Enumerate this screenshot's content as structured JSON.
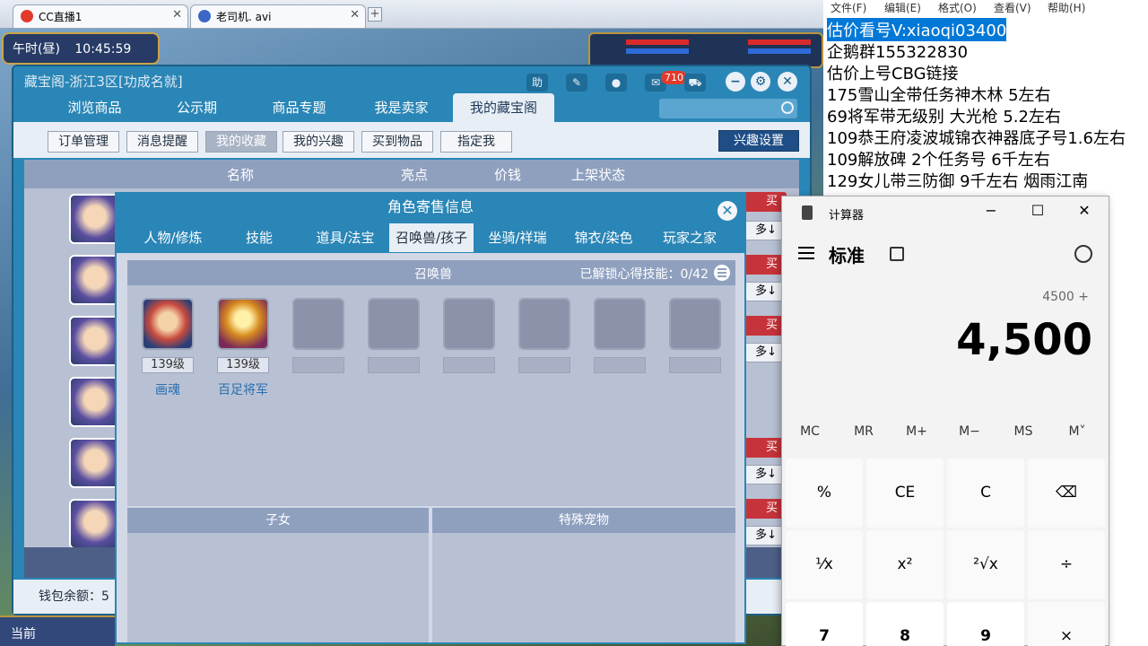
{
  "browser": {
    "tabs": [
      {
        "title": "CC直播1"
      },
      {
        "title": "老司机. avi"
      }
    ],
    "new_tab": "+"
  },
  "game_hud": {
    "time_label": "午时(昼)",
    "clock": "10:45:59",
    "bottom_label": "当前"
  },
  "window": {
    "title": "藏宝阁-浙江3区[功成名就]",
    "header_buttons": {
      "help": "助",
      "message_count": "710"
    },
    "nav_tabs": [
      "浏览商品",
      "公示期",
      "商品专题",
      "我是卖家",
      "我的藏宝阁"
    ],
    "active_nav": 4,
    "sub_buttons": [
      "订单管理",
      "消息提醒",
      "我的收藏",
      "我的兴趣",
      "买到物品",
      "指定我"
    ],
    "active_sub": 2,
    "interest_button": "兴趣设置",
    "columns": [
      "名称",
      "亮点",
      "价钱",
      "上架状态"
    ],
    "buy_label": "买",
    "more_label": "多↓",
    "wallet_label": "钱包余额：5"
  },
  "dialog": {
    "title": "角色寄售信息",
    "tabs": [
      "人物/修炼",
      "技能",
      "道具/法宝",
      "召唤兽/孩子",
      "坐骑/祥瑞",
      "锦衣/染色",
      "玩家之家"
    ],
    "active_tab": 3,
    "pet_section_title": "召唤兽",
    "unlock_text": "已解锁心得技能：0/42",
    "pets": [
      {
        "level": "139级",
        "name": "画魂"
      },
      {
        "level": "139级",
        "name": "百足将军"
      }
    ],
    "children_title": "子女",
    "special_pet_title": "特殊宠物"
  },
  "notepad": {
    "menu": [
      "文件(F)",
      "编辑(E)",
      "格式(O)",
      "查看(V)",
      "帮助(H)"
    ],
    "lines": [
      "估价看号V:xiaoqi03400",
      "企鹅群155322830",
      "估价上号CBG链接",
      "175雪山全带任务神木林 5左右",
      "69将军带无级别 大光枪 5.2左右",
      "109恭王府凌波城锦衣神器底子号1.6左右",
      "109解放碑 2个任务号 6千左右",
      "129女儿带三防御 9千左右 烟雨江南"
    ]
  },
  "calculator": {
    "title": "计算器",
    "mode": "标准",
    "expression": "4500 +",
    "display": "4,500",
    "memory": [
      "MC",
      "MR",
      "M+",
      "M−",
      "MS",
      "M˅"
    ],
    "keys": [
      "%",
      "CE",
      "C",
      "⌫",
      "¹⁄x",
      "x²",
      "²√x",
      "÷",
      "7",
      "8",
      "9",
      "×"
    ]
  }
}
